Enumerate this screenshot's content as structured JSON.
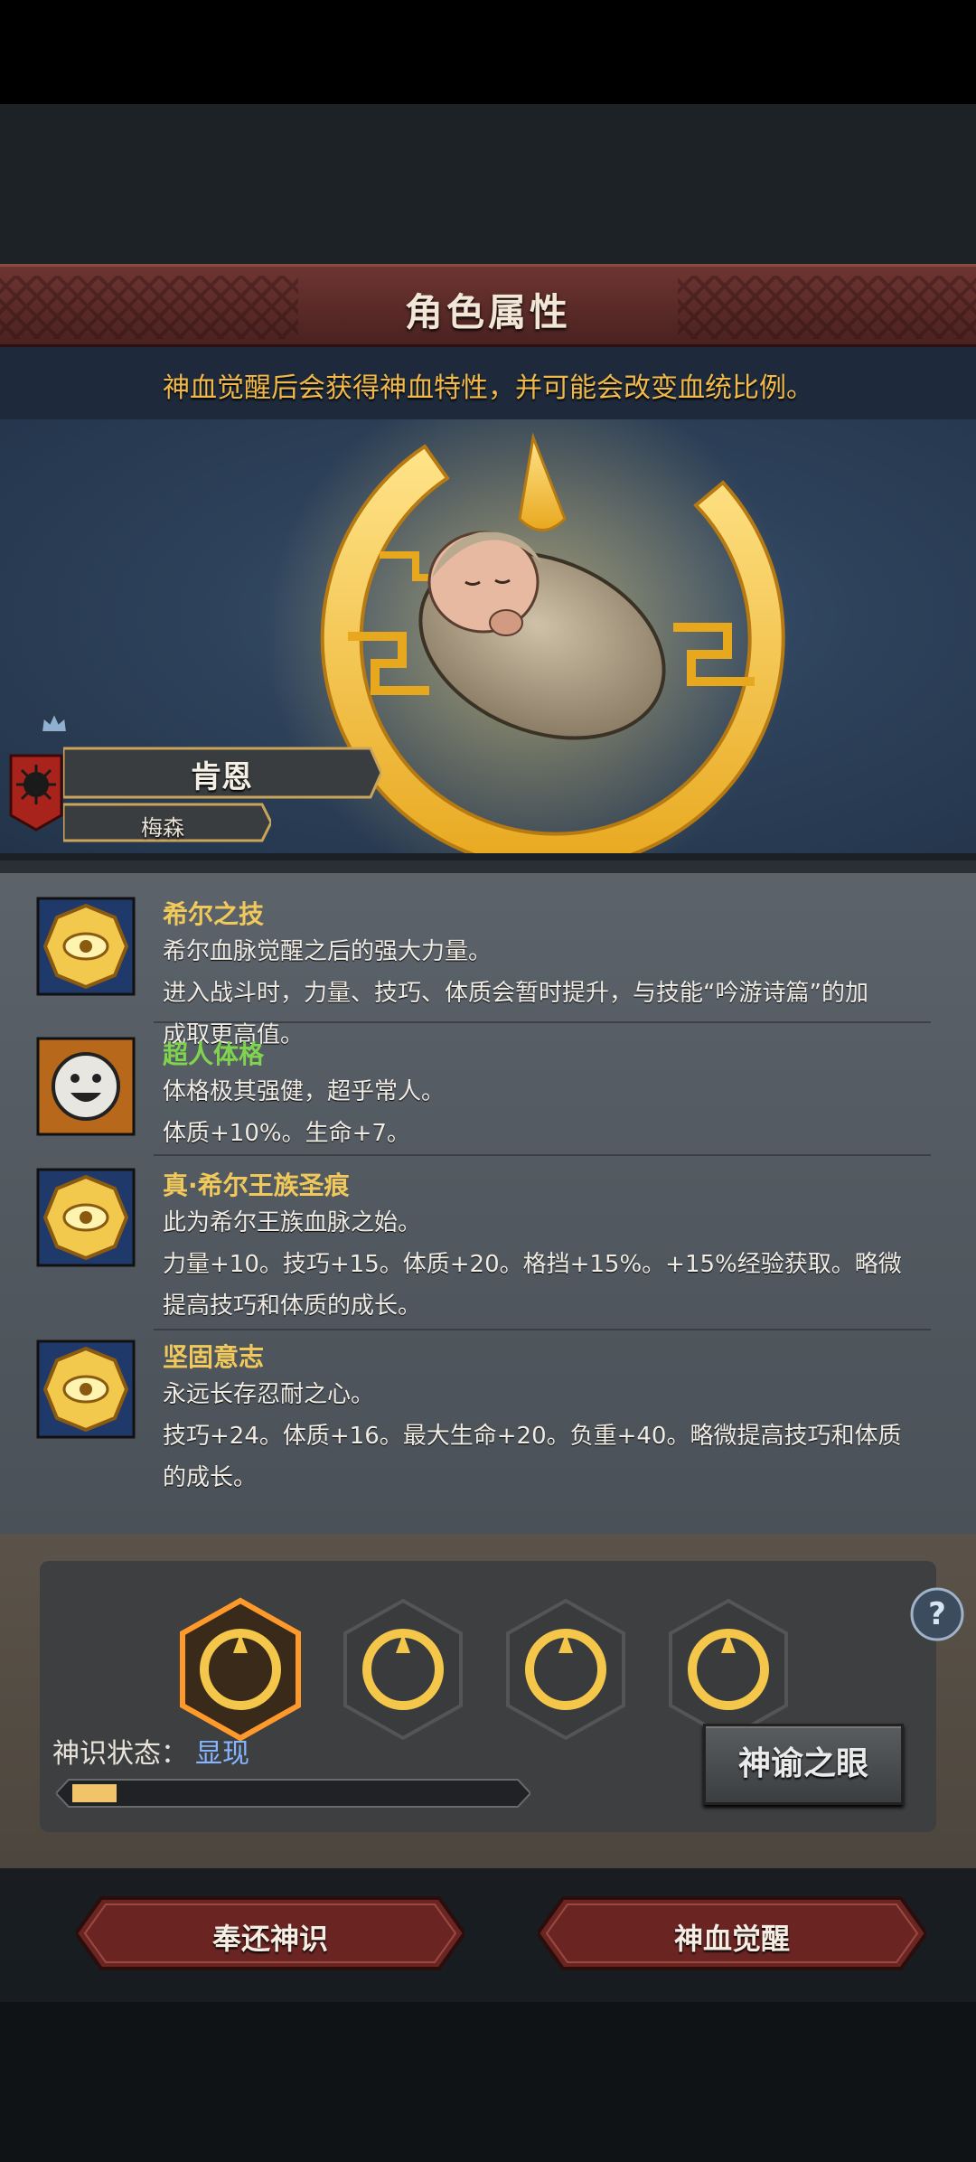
{
  "header": {
    "title": "角色属性",
    "subtitle": "神血觉醒后会获得神血特性，并可能会改变血统比例。"
  },
  "character": {
    "name": "肯恩",
    "sub_name": "梅森"
  },
  "traits": [
    {
      "name": "希尔之技",
      "name_color": "#f1c95a",
      "icon": "golden-eye-emblem-icon",
      "lines": [
        "希尔血脉觉醒之后的强大力量。",
        "进入战斗时，力量、技巧、体质会暂时提升，与技能“吟游诗篇”的加",
        "成取更高值。"
      ]
    },
    {
      "name": "超人体格",
      "name_color": "#7fd34e",
      "icon": "smiley-face-icon",
      "lines": [
        "体格极其强健，超乎常人。",
        "体质+10%。生命+7。"
      ]
    },
    {
      "name": "真·希尔王族圣痕",
      "name_color": "#f1c95a",
      "icon": "golden-eye-emblem-icon",
      "lines": [
        "此为希尔王族血脉之始。",
        "力量+10。技巧+15。体质+20。格挡+15%。+15%经验获取。略微",
        "提高技巧和体质的成长。"
      ]
    },
    {
      "name": "坚固意志",
      "name_color": "#f1c95a",
      "icon": "golden-eye-emblem-icon",
      "lines": [
        "永远长存忍耐之心。",
        "技巧+24。体质+16。最大生命+20。负重+40。略微提高技巧和体质",
        "的成长。"
      ]
    }
  ],
  "divine_sense": {
    "status_label": "神识状态：",
    "status_value": "显现",
    "progress_fraction": 0.1,
    "oracle_button": "神谕之眼",
    "slots": [
      {
        "icon": "divine-emblem-icon",
        "selected": true
      },
      {
        "icon": "divine-emblem-icon",
        "selected": false
      },
      {
        "icon": "divine-emblem-icon",
        "selected": false
      },
      {
        "icon": "divine-emblem-icon",
        "selected": false
      }
    ]
  },
  "actions": {
    "return_label": "奉还神识",
    "awaken_label": "神血觉醒"
  },
  "colors": {
    "header_bg": "#5a2a28",
    "subtitle": "#f1b94a",
    "progress_fill": "#f2c46a",
    "status_value": "#86b6ff",
    "gold": "#f4c74a"
  }
}
